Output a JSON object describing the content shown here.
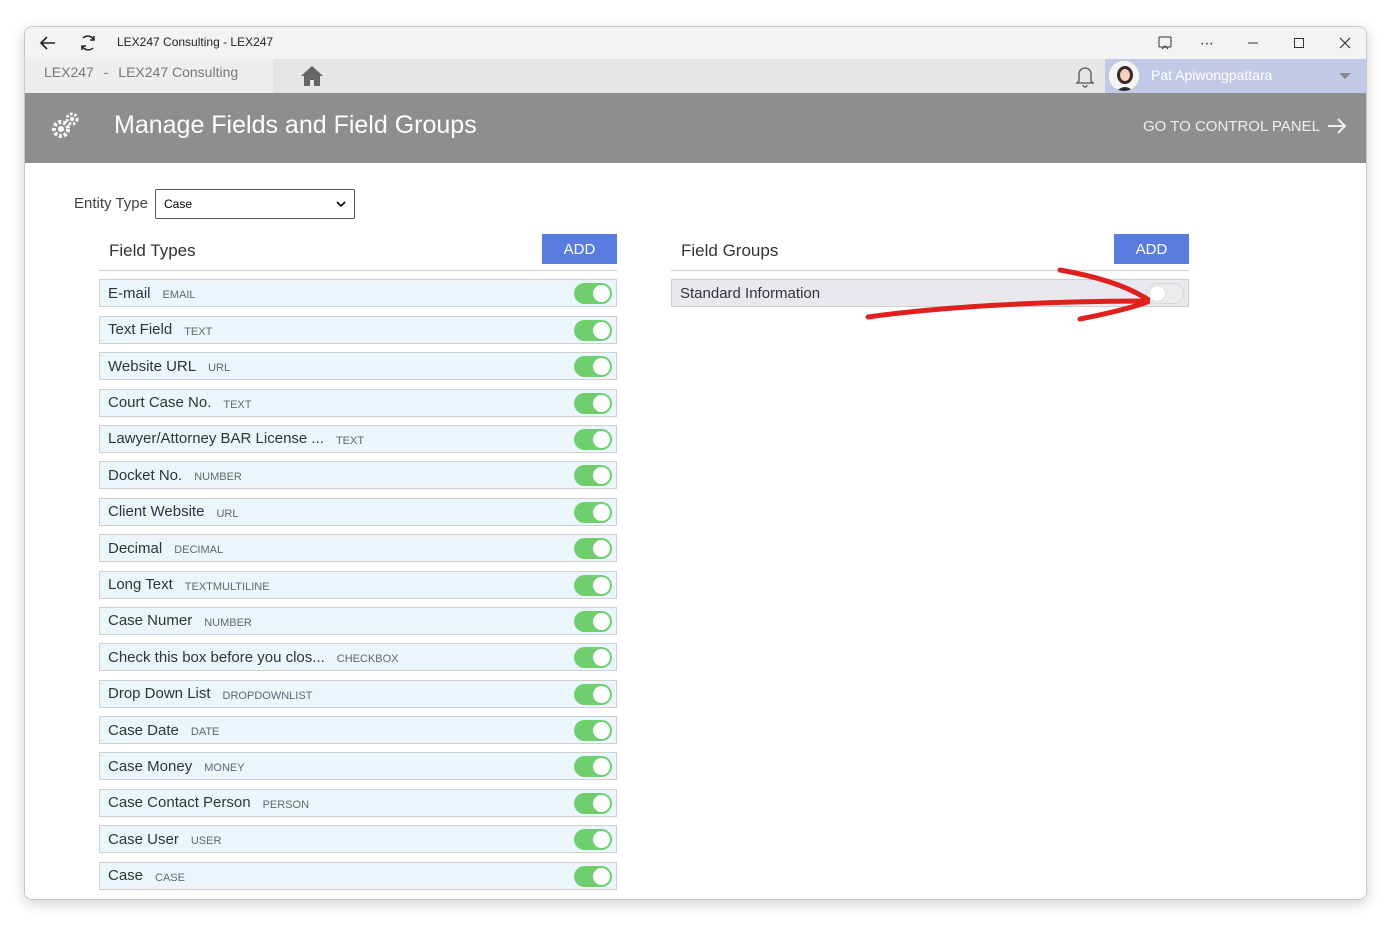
{
  "window": {
    "title": "LEX247 Consulting - LEX247"
  },
  "appbar": {
    "breadcrumb_org": "LEX247",
    "breadcrumb_sep": "-",
    "breadcrumb_name": "LEX247 Consulting",
    "user_name": "Pat Apiwongpattara"
  },
  "page": {
    "title": "Manage Fields and Field Groups",
    "control_panel_link": "GO TO CONTROL PANEL"
  },
  "entity": {
    "label": "Entity Type",
    "selected": "Case"
  },
  "field_types": {
    "title": "Field Types",
    "add_label": "ADD",
    "items": [
      {
        "name": "E-mail",
        "type": "EMAIL",
        "enabled": true
      },
      {
        "name": "Text Field",
        "type": "TEXT",
        "enabled": true
      },
      {
        "name": "Website URL",
        "type": "URL",
        "enabled": true
      },
      {
        "name": "Court Case No.",
        "type": "TEXT",
        "enabled": true
      },
      {
        "name": "Lawyer/Attorney BAR License ...",
        "type": "TEXT",
        "enabled": true
      },
      {
        "name": "Docket No.",
        "type": "NUMBER",
        "enabled": true
      },
      {
        "name": "Client Website",
        "type": "URL",
        "enabled": true
      },
      {
        "name": "Decimal",
        "type": "DECIMAL",
        "enabled": true
      },
      {
        "name": "Long Text",
        "type": "TEXTMULTILINE",
        "enabled": true
      },
      {
        "name": "Case Numer",
        "type": "NUMBER",
        "enabled": true
      },
      {
        "name": "Check this box before you clos...",
        "type": "CHECKBOX",
        "enabled": true
      },
      {
        "name": "Drop Down List",
        "type": "DROPDOWNLIST",
        "enabled": true
      },
      {
        "name": "Case Date",
        "type": "DATE",
        "enabled": true
      },
      {
        "name": "Case Money",
        "type": "MONEY",
        "enabled": true
      },
      {
        "name": "Case Contact Person",
        "type": "PERSON",
        "enabled": true
      },
      {
        "name": "Case User",
        "type": "USER",
        "enabled": true
      },
      {
        "name": "Case",
        "type": "CASE",
        "enabled": true
      }
    ]
  },
  "field_groups": {
    "title": "Field Groups",
    "add_label": "ADD",
    "items": [
      {
        "name": "Standard Information",
        "enabled": false
      }
    ]
  },
  "colors": {
    "accent": "#5a7be0",
    "header_bg": "#8e8e8e",
    "toggle_on": "#6fcf6f",
    "annotation": "#e0201c"
  }
}
